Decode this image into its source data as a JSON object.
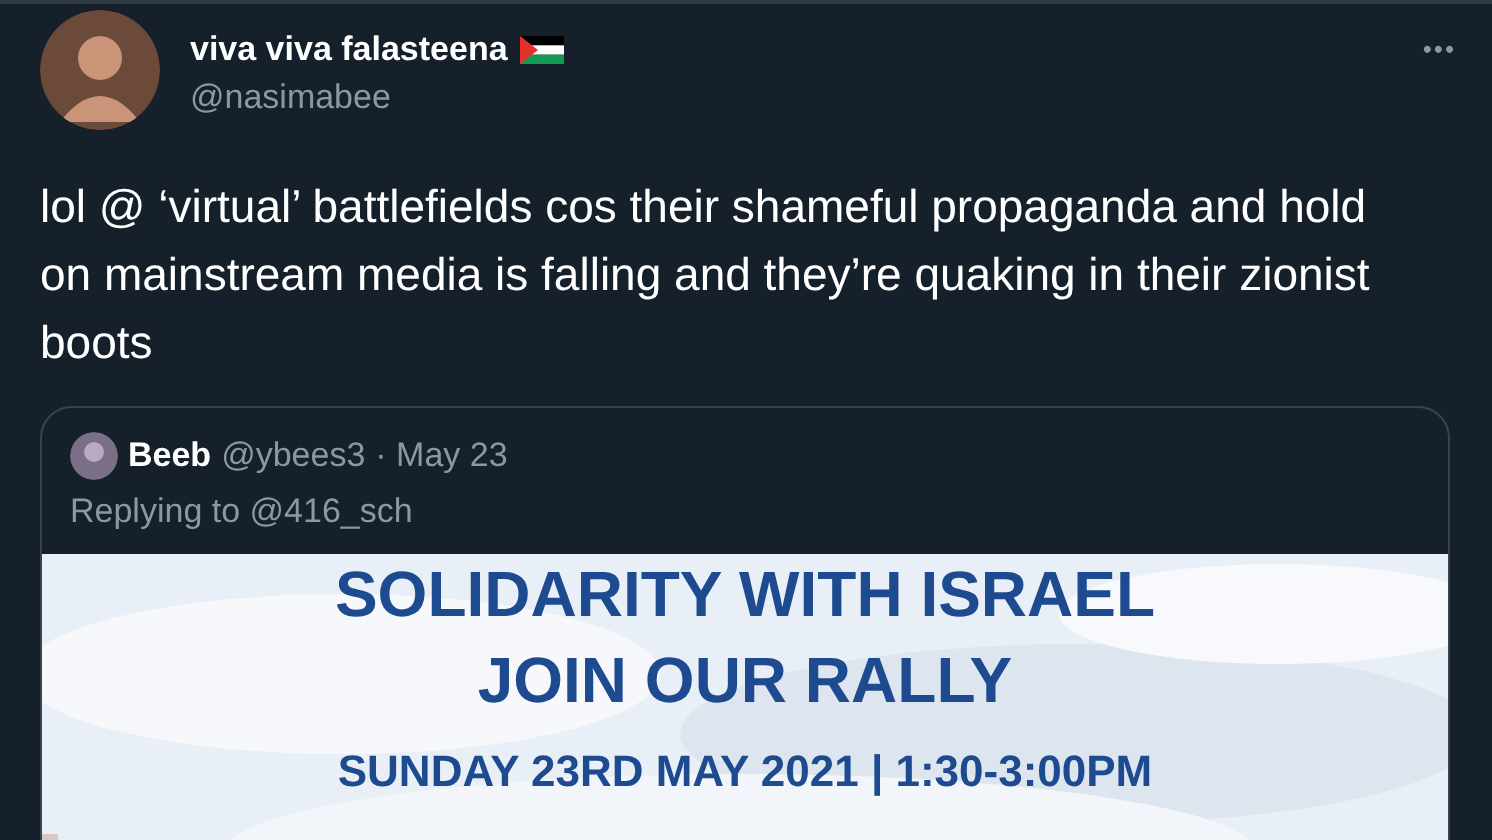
{
  "tweet": {
    "author": {
      "name": "viva viva falasteena",
      "handle": "@nasimabee"
    },
    "more": "•••",
    "text": "lol @ ‘virtual’ battlefields cos their shameful propaganda and hold on mainstream media is falling and they’re quaking in their zionist boots",
    "quoted": {
      "author": {
        "name": "Beeb",
        "handle": "@ybees3",
        "date": "· May 23"
      },
      "replying": "Replying to @416_sch",
      "image": {
        "lines": [
          "SOLIDARITY WITH ISRAEL",
          "JOIN OUR RALLY",
          "SUNDAY 23RD MAY 2021 | 1:30-3:00PM"
        ]
      }
    }
  }
}
